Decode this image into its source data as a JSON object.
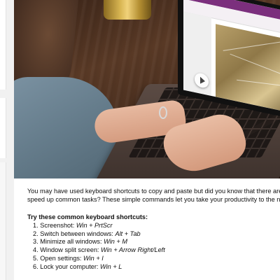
{
  "article": {
    "intro_line_1": "You may have used keyboard shortcuts to copy and paste but did you know that there are many more",
    "intro_line_2": "speed up common tasks? These simple commands let you take your productivity to the next level wit",
    "list_heading": "Try these common keyboard shortcuts:",
    "shortcuts": [
      {
        "number": "1.",
        "label": "Screenshot:",
        "keys": "Win + PrtScr"
      },
      {
        "number": "2.",
        "label": "Switch between windows:",
        "keys": "Alt + Tab"
      },
      {
        "number": "3.",
        "label": "Minimize all windows:",
        "keys": "Win + M"
      },
      {
        "number": "4.",
        "label": "Window split screen:",
        "keys": "Win + Arrow Right/Left"
      },
      {
        "number": "5.",
        "label": "Open settings:",
        "keys": "Win + I"
      },
      {
        "number": "6.",
        "label": "Lock your computer:",
        "keys": "Win + L"
      }
    ]
  },
  "hero": {
    "icon": "play-icon"
  },
  "colors": {
    "onenote_purple": "#7b2f7d",
    "text": "#111111",
    "page_bg": "#f1f1f1"
  }
}
